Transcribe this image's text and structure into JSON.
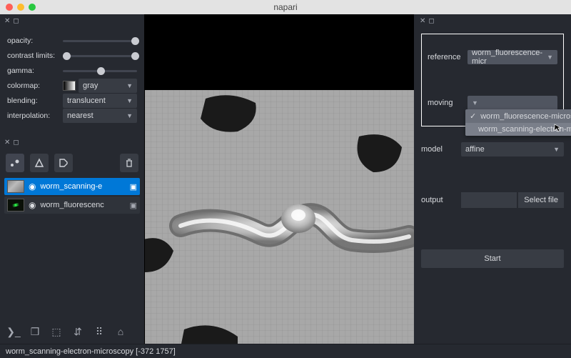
{
  "window": {
    "title": "napari"
  },
  "controls": {
    "opacity": {
      "label": "opacity:",
      "value": 1.0
    },
    "contrast": {
      "label": "contrast limits:"
    },
    "gamma": {
      "label": "gamma:",
      "value": 0.5
    },
    "colormap": {
      "label": "colormap:",
      "value": "gray"
    },
    "blending": {
      "label": "blending:",
      "value": "translucent"
    },
    "interpolation": {
      "label": "interpolation:",
      "value": "nearest"
    }
  },
  "layers": [
    {
      "name": "worm_scanning-e",
      "selected": true,
      "thumb": "sem"
    },
    {
      "name": "worm_fluorescenc",
      "selected": false,
      "thumb": "flu"
    }
  ],
  "viewer_buttons": [
    "console",
    "ndisplay",
    "roll",
    "transpose",
    "grid",
    "home"
  ],
  "registration": {
    "reference": {
      "label": "reference",
      "value": "worm_fluorescence-micr"
    },
    "moving": {
      "label": "moving",
      "value": "worm_fluorescence-microscopy",
      "options": [
        {
          "label": "worm_fluorescence-microscopy",
          "checked": true
        },
        {
          "label": "worm_scanning-electron-micros",
          "checked": false,
          "highlighted": true
        }
      ]
    },
    "model": {
      "label": "model",
      "value": "affine"
    },
    "output": {
      "label": "output",
      "select_file": "Select file"
    },
    "start": "Start"
  },
  "status": "worm_scanning-electron-microscopy [-372 1757]"
}
